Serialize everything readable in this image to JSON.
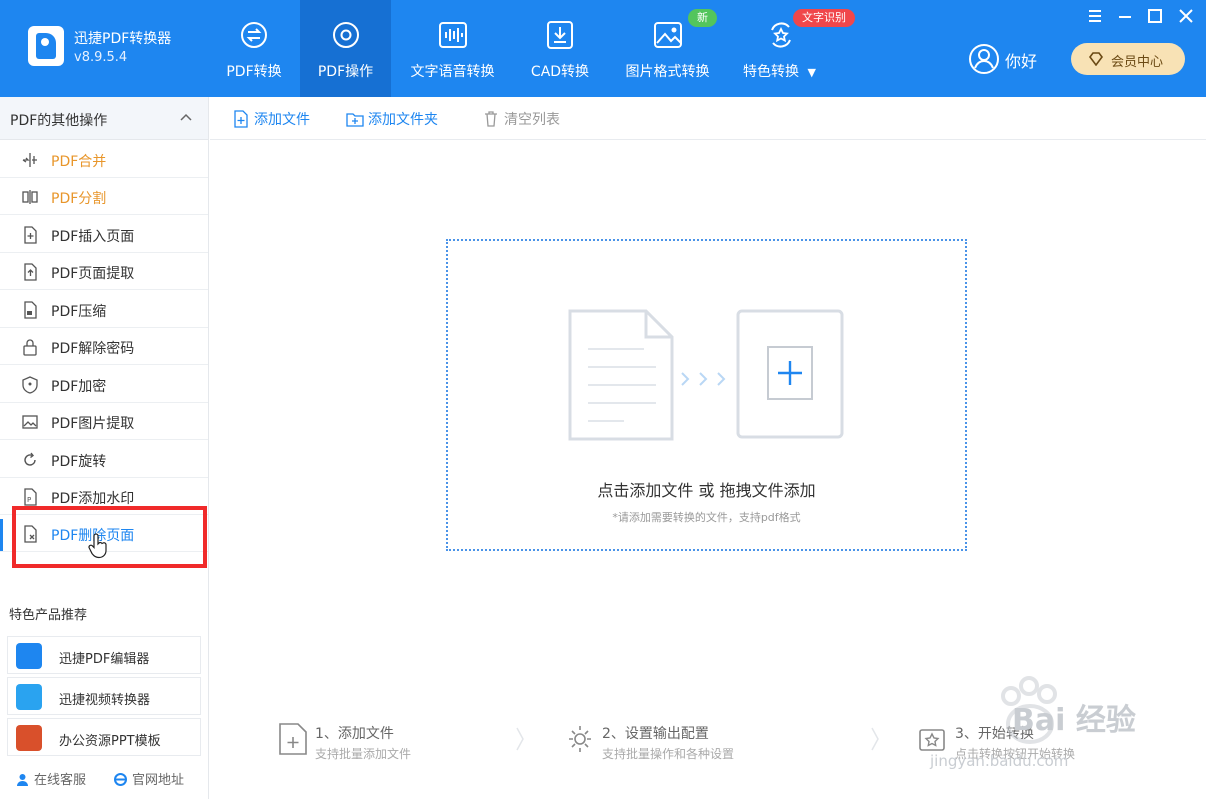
{
  "app": {
    "name": "迅捷PDF转换器",
    "version": "v8.9.5.4"
  },
  "nav": {
    "tabs": [
      {
        "label": "PDF转换",
        "icon": "convert-icon"
      },
      {
        "label": "PDF操作",
        "icon": "gear-icon",
        "active": true
      },
      {
        "label": "文字语音转换",
        "icon": "audio-wave-icon"
      },
      {
        "label": "CAD转换",
        "icon": "cad-icon"
      },
      {
        "label": "图片格式转换",
        "icon": "image-icon"
      },
      {
        "label": "特色转换",
        "icon": "star-convert-icon"
      }
    ],
    "badge_new": "新",
    "badge_ocr": "文字识别"
  },
  "user": {
    "name": "你好",
    "vip_label": "会员中心"
  },
  "sidebar": {
    "section_title": "PDF的其他操作",
    "items": [
      {
        "label": "PDF合并",
        "icon": "merge-icon"
      },
      {
        "label": "PDF分割",
        "icon": "split-icon"
      },
      {
        "label": "PDF插入页面",
        "icon": "insert-page-icon"
      },
      {
        "label": "PDF页面提取",
        "icon": "extract-page-icon"
      },
      {
        "label": "PDF压缩",
        "icon": "compress-icon"
      },
      {
        "label": "PDF解除密码",
        "icon": "unlock-icon"
      },
      {
        "label": "PDF加密",
        "icon": "shield-icon"
      },
      {
        "label": "PDF图片提取",
        "icon": "image-extract-icon"
      },
      {
        "label": "PDF旋转",
        "icon": "rotate-icon"
      },
      {
        "label": "PDF添加水印",
        "icon": "watermark-icon"
      },
      {
        "label": "PDF删除页面",
        "icon": "delete-page-icon"
      }
    ],
    "featured_title": "特色产品推荐",
    "featured": [
      {
        "label": "迅捷PDF编辑器",
        "icon": "pdf-editor-icon"
      },
      {
        "label": "迅捷视频转换器",
        "icon": "video-converter-icon"
      },
      {
        "label": "办公资源PPT模板",
        "icon": "ppt-template-icon"
      }
    ],
    "footer": {
      "service": "在线客服",
      "website": "官网地址"
    }
  },
  "toolbar": {
    "add_file": "添加文件",
    "add_folder": "添加文件夹",
    "clear_list": "清空列表"
  },
  "dropzone": {
    "title": "点击添加文件 或 拖拽文件添加",
    "subtitle": "*请添加需要转换的文件，支持pdf格式"
  },
  "steps": [
    {
      "title": "1、添加文件",
      "sub": "支持批量添加文件"
    },
    {
      "title": "2、设置输出配置",
      "sub": "支持批量操作和各种设置"
    },
    {
      "title": "3、开始转换",
      "sub": "点击转换按钮开始转换"
    }
  ],
  "watermark": {
    "text": "Bai 经验",
    "url": "jingyan.baidu.com"
  },
  "colors": {
    "brand_blue": "#1e86f0",
    "active_tab": "#1670d3",
    "orange": "#e8962b",
    "highlight_red": "#f02a2a",
    "vip_gold": "#f8e2b5"
  }
}
